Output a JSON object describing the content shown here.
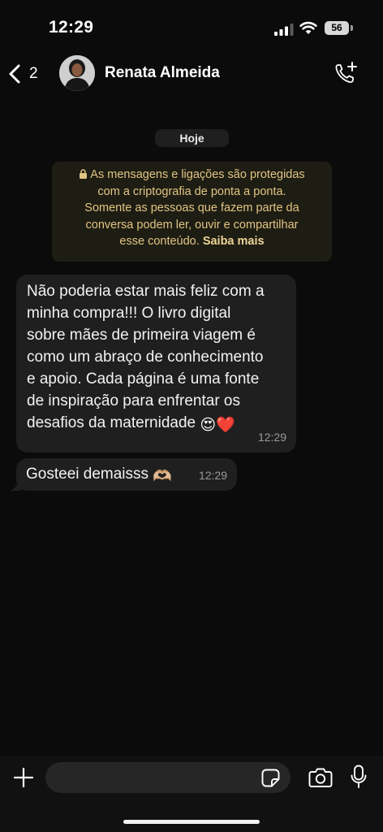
{
  "status_bar": {
    "time": "12:29",
    "battery_level": "56"
  },
  "header": {
    "unread_count": "2",
    "contact_name": "Renata Almeida"
  },
  "chat": {
    "date_label": "Hoje",
    "encryption_notice": {
      "text_lines": [
        "As mensagens e ligações são protegidas",
        "com a criptografia de ponta a ponta.",
        "Somente as pessoas que fazem parte da",
        "conversa podem ler, ouvir e compartilhar",
        "esse conteúdo."
      ],
      "link_label": "Saiba mais"
    },
    "messages": [
      {
        "lines": [
          "Não poderia estar mais feliz com a",
          "minha compra!!! O livro digital",
          "sobre mães de primeira viagem é",
          "como um abraço de conhecimento",
          "e apoio. Cada página é uma fonte",
          "de inspiração para enfrentar os",
          "desafios da maternidade"
        ],
        "emojis": [
          "😍",
          "❤️"
        ],
        "time": "12:29"
      },
      {
        "text": "Gosteei demaisss",
        "emoji": "🫶🏼",
        "time": "12:29"
      }
    ]
  },
  "colors": {
    "background": "#0b0b0b",
    "bubble": "#1f1f1f",
    "notice_bg": "#1e1d14",
    "notice_text": "#e1c582"
  },
  "icons": [
    "signal-icon",
    "wifi-icon",
    "battery-icon",
    "back-chevron-icon",
    "add-call-icon",
    "lock-icon",
    "plus-icon",
    "sticker-icon",
    "camera-icon",
    "mic-icon"
  ]
}
